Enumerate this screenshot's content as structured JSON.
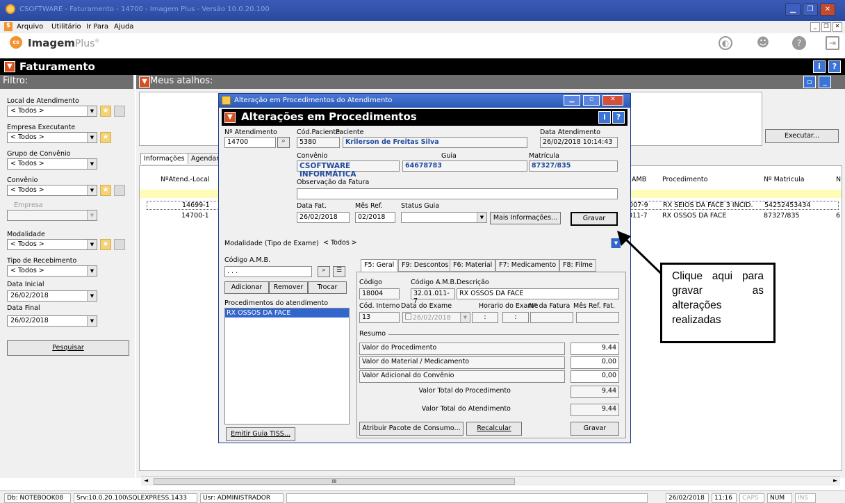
{
  "window": {
    "title": "CSOFTWARE - Faturamento - 14700 - Imagem Plus - Versão 10.0.20.100"
  },
  "menu": {
    "items": [
      "Arquivo",
      "Utilitário",
      "Ir Para",
      "Ajuda"
    ]
  },
  "app": {
    "logo_text": "ImagemPlus",
    "logo_main": "Imagem",
    "logo_sub": "Plus",
    "logo_badge": "cs"
  },
  "module": {
    "title": "Faturamento"
  },
  "filter": {
    "title": "Filtro:",
    "local_label": "Local de Atendimento",
    "local_value": "< Todos >",
    "empresa_exec_label": "Empresa Executante",
    "empresa_exec_value": "< Todos >",
    "grupo_label": "Grupo de Convênio",
    "grupo_value": "< Todos >",
    "convenio_label": "Convênio",
    "convenio_value": "< Todos >",
    "empresa_label": "Empresa",
    "modalidade_label": "Modalidade",
    "modalidade_value": "< Todos >",
    "tipo_receb_label": "Tipo de Recebimento",
    "tipo_receb_value": "< Todos >",
    "data_inicial_label": "Data Inicial",
    "data_inicial_value": "26/02/2018",
    "data_final_label": "Data Final",
    "data_final_value": "26/02/2018",
    "pesquisar": "Pesquisar"
  },
  "shortcuts": {
    "title": "Meus atalhos:",
    "executar": "Executar..."
  },
  "tabs": {
    "informacoes": "Informações",
    "agendam": "Agendam"
  },
  "grid": {
    "col_atend": "NºAtend.-Local",
    "col_amb": "AMB",
    "col_proc": "Procedimento",
    "col_matr": "Nº Matricula",
    "col_n": "N",
    "rows": [
      {
        "atend": "14699-1",
        "amb": ".007-9",
        "proc": "RX SEIOS DA FACE 3 INCID.",
        "matr": "54252453434"
      },
      {
        "atend": "14700-1",
        "amb": ".011-7",
        "proc": "RX OSSOS DA FACE",
        "matr": "87327/835",
        "extra": "6"
      }
    ],
    "scroll_mark": "III"
  },
  "dialog": {
    "window_title": "Alteração em Procedimentos do Atendimento",
    "header": "Alterações em Procedimentos",
    "natend_label": "Nº Atendimento",
    "natend_value": "14700",
    "codpac_label": "Cód.Paciente",
    "codpac_value": "5380",
    "paciente_label": "Paciente",
    "paciente_value": "Krilerson de Freitas Silva",
    "data_atend_label": "Data Atendimento",
    "data_atend_value": "26/02/2018 10:14:43",
    "convenio_label": "Convênio",
    "convenio_value": "CSOFTWARE INFORMÁTICA",
    "guia_label": "Guia",
    "guia_value": "64678783",
    "matricula_label": "Matrícula",
    "matricula_value": "87327/835",
    "obs_label": "Observação da Fatura",
    "obs_value": "",
    "datafat_label": "Data Fat.",
    "datafat_value": "26/02/2018",
    "mesref_label": "Mês Ref.",
    "mesref_value": "02/2018",
    "status_label": "Status Guia",
    "status_value": "",
    "mais_info": "Mais Informações...",
    "gravar_top": "Gravar",
    "modalidade_label": "Modalidade (Tipo de Exame)",
    "modalidade_value": "< Todos >",
    "codamb_label": "Código A.M.B.",
    "codamb_value": ". . .",
    "adicionar": "Adicionar",
    "remover": "Remover",
    "trocar": "Trocar",
    "proc_atend_label": "Procedimentos do atendimento",
    "proc_item": "RX OSSOS DA FACE",
    "emitir": "Emitir Guia TISS...",
    "subtabs": [
      "F5: Geral",
      "F9: Descontos",
      "F6: Material",
      "F7: Medicamento",
      "F8: Filme"
    ],
    "codigo_label": "Código",
    "codigo_value": "18004",
    "codamb2_label": "Código A.M.B.",
    "codamb2_value": "32.01.011-7",
    "descricao_label": "Descrição",
    "descricao_value": "RX OSSOS DA FACE",
    "codint_label": "Cód. Interno",
    "codint_value": "13",
    "dataexame_label": "Data do Exame",
    "dataexame_value": "26/02/2018",
    "horario_label": "Horario do Exame",
    "horario_value": ":",
    "nfatura_label": "Nº da Fatura",
    "mesreffat_label": "Mês Ref. Fat.",
    "resumo_label": "Resumo",
    "valor_proc_label": "Valor do Procedimento",
    "valor_proc": "9,44",
    "valor_mat_label": "Valor do Material / Medicamento",
    "valor_mat": "0,00",
    "valor_adic_label": "Valor Adicional do Convênio",
    "valor_adic": "0,00",
    "total_proc_label": "Valor Total do Procedimento",
    "total_proc": "9,44",
    "total_atend_label": "Valor Total do Atendimento",
    "total_atend": "9,44",
    "atribuir": "Atribuir Pacote de Consumo...",
    "recalcular": "Recalcular",
    "gravar_bottom": "Gravar"
  },
  "callout": {
    "text": "Clique aqui para gravar as alterações realizadas"
  },
  "status": {
    "db": "Db: NOTEBOOK08",
    "srv": "Srv:10.0.20.100\\SQLEXPRESS.1433",
    "usr": "Usr: ADMINISTRADOR",
    "date": "26/02/2018",
    "time": "11:16",
    "caps": "CAPS",
    "num": "NUM",
    "ins": "INS"
  },
  "colors": {
    "title_blue": "#2a4a9e",
    "header_black": "#000000",
    "accent_orange": "#f29231",
    "selected_blue": "#3366cc"
  }
}
